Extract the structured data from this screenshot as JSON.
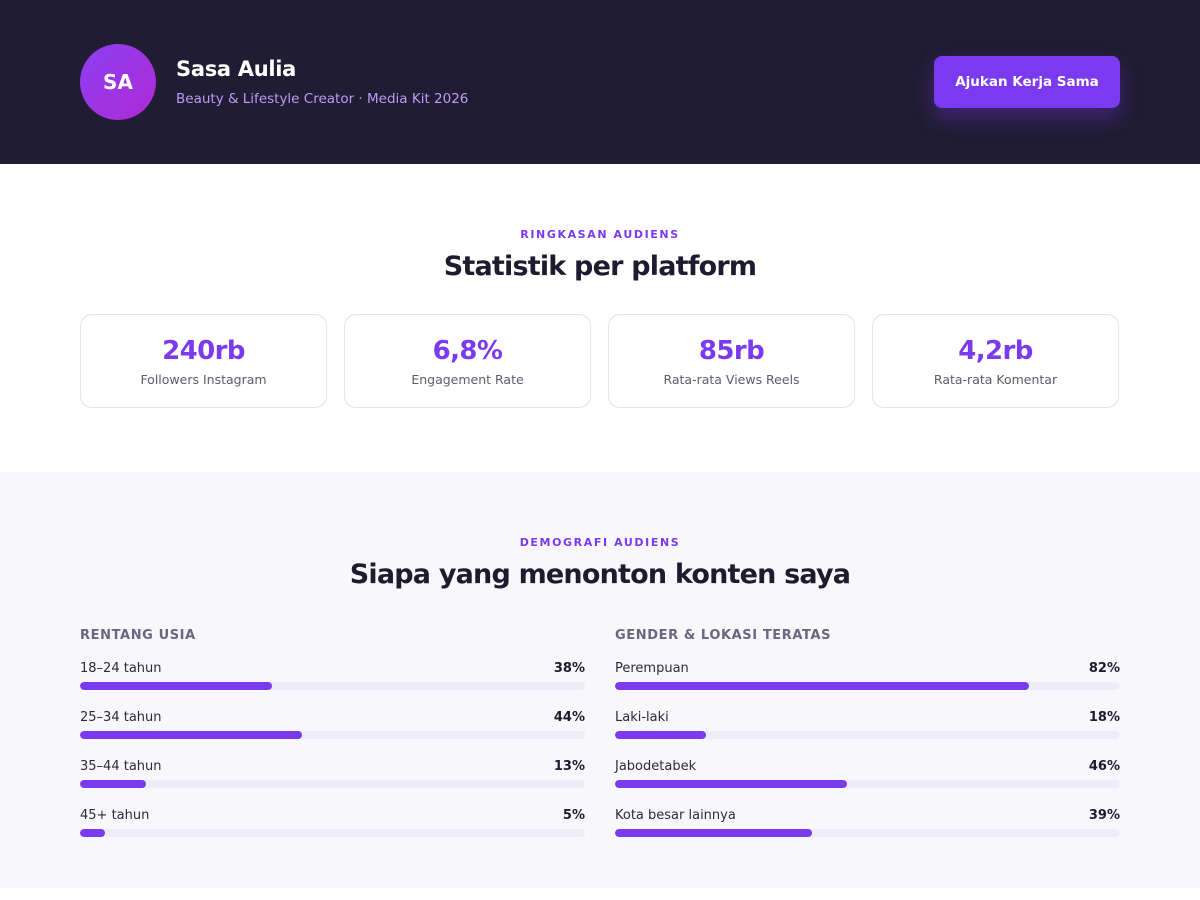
{
  "header": {
    "avatar_initials": "SA",
    "name": "Sasa Aulia",
    "tagline": "Beauty & Lifestyle Creator · Media Kit 2026",
    "cta_label": "Ajukan Kerja Sama"
  },
  "stats": {
    "eyebrow": "RINGKASAN AUDIENS",
    "title": "Statistik per platform",
    "cards": [
      {
        "value": "240rb",
        "label": "Followers Instagram"
      },
      {
        "value": "6,8%",
        "label": "Engagement Rate"
      },
      {
        "value": "85rb",
        "label": "Rata-rata Views Reels"
      },
      {
        "value": "4,2rb",
        "label": "Rata-rata Komentar"
      }
    ]
  },
  "demographics": {
    "eyebrow": "DEMOGRAFI AUDIENS",
    "title": "Siapa yang menonton konten saya",
    "age": {
      "title": "RENTANG USIA",
      "rows": [
        {
          "label": "18–24 tahun",
          "pct_text": "38%",
          "pct": 38
        },
        {
          "label": "25–34 tahun",
          "pct_text": "44%",
          "pct": 44
        },
        {
          "label": "35–44 tahun",
          "pct_text": "13%",
          "pct": 13
        },
        {
          "label": "45+ tahun",
          "pct_text": "5%",
          "pct": 5
        }
      ]
    },
    "gender_location": {
      "title": "GENDER & LOKASI TERATAS",
      "rows": [
        {
          "label": "Perempuan",
          "pct_text": "82%",
          "pct": 82
        },
        {
          "label": "Laki-laki",
          "pct_text": "18%",
          "pct": 18
        },
        {
          "label": "Jabodetabek",
          "pct_text": "46%",
          "pct": 46
        },
        {
          "label": "Kota besar lainnya",
          "pct_text": "39%",
          "pct": 39
        }
      ]
    }
  },
  "colors": {
    "accent": "#7b3af0",
    "header_bg": "#201c33",
    "section_bg": "#f8f7fb",
    "track": "#efecf7"
  }
}
